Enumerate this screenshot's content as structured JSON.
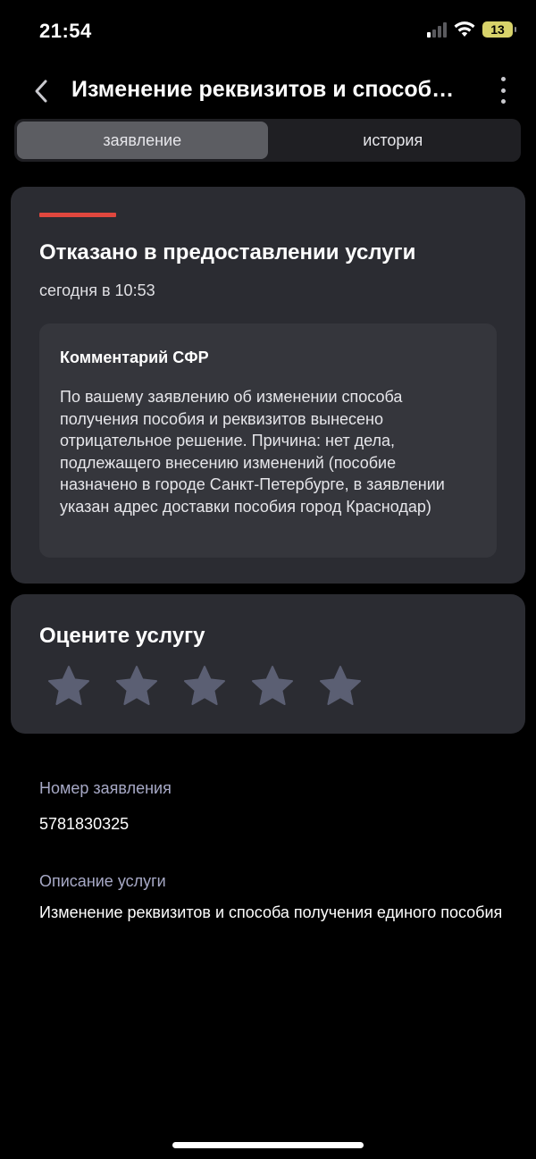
{
  "status_bar": {
    "time": "21:54",
    "battery": "13"
  },
  "header": {
    "title": "Изменение реквизитов и способа получения единого пособия",
    "back_icon": "chevron-left-icon",
    "more_icon": "more-vertical-icon"
  },
  "tabs": [
    {
      "label": "заявление",
      "active": true
    },
    {
      "label": "история",
      "active": false
    }
  ],
  "status_card": {
    "accent_color": "#e0473e",
    "title": "Отказано в предоставлении услуги",
    "date": "сегодня в 10:53",
    "comment": {
      "title": "Комментарий СФР",
      "text": "По вашему заявлению об изменении способа получения пособия и реквизитов вынесено отрицательное решение. Причина: нет дела, подлежащего внесению изменений (пособие назначено в городе Санкт-Петербурге, в заявлении указан адрес доставки пособия город Краснодар)"
    }
  },
  "rating": {
    "title": "Оцените услугу",
    "max_stars": 5,
    "selected": 0,
    "star_color": "#5b5f73"
  },
  "info": {
    "number_label": "Номер заявления",
    "number_value": "5781830325",
    "description_label": "Описание услуги",
    "description_value": "Изменение реквизитов и способа получения единого пособия"
  }
}
